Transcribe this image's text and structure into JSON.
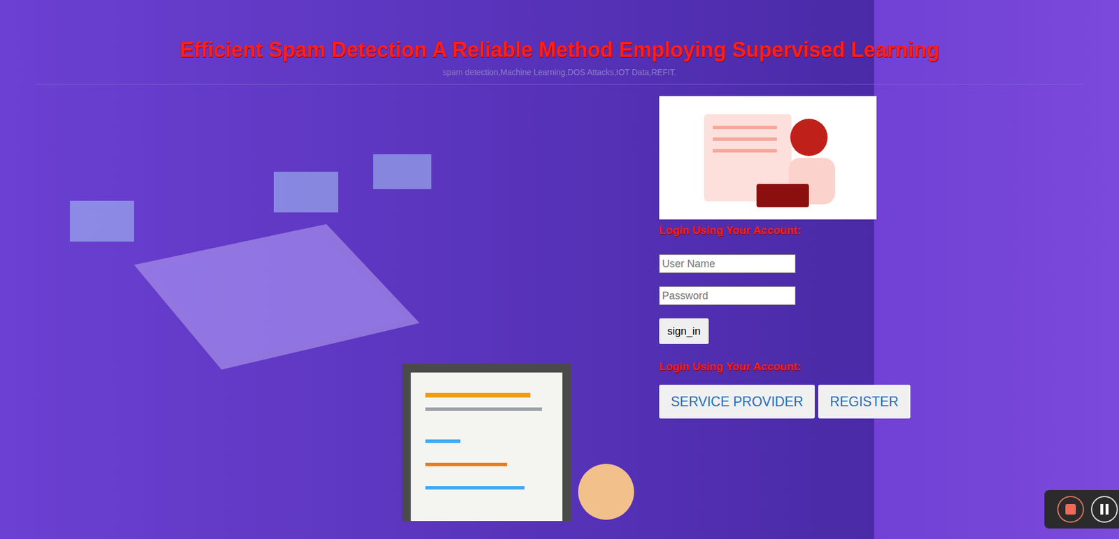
{
  "page": {
    "title": "Efficient Spam Detection A Reliable Method Employing Supervised Learning",
    "subtitle": "spam detection,Machine Learning,DOS Attacks,IOT Data,REFIT."
  },
  "login": {
    "heading": "Login Using Your Account:",
    "fields": [
      {
        "placeholder": "User Name",
        "kind": "text"
      },
      {
        "placeholder": "Password",
        "kind": "password"
      }
    ],
    "submit": "sign_in"
  },
  "other": {
    "heading": "Login Using Your Account:",
    "buttons": [
      "SERVICE PROVIDER",
      "REGISTER"
    ]
  }
}
